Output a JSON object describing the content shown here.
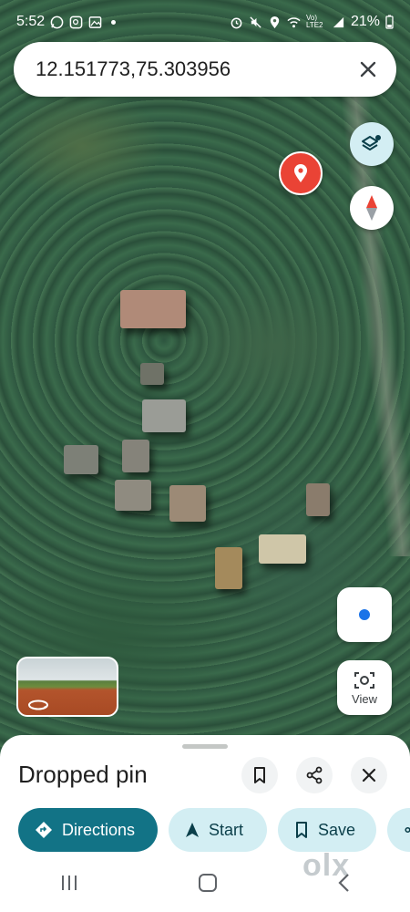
{
  "status_bar": {
    "time": "5:52",
    "network_label": "Vo) LTE2",
    "battery": "21%"
  },
  "search": {
    "query": "12.151773,75.303956"
  },
  "map_controls": {
    "view_label": "View"
  },
  "place_sheet": {
    "title": "Dropped pin",
    "actions": [
      {
        "label": "Directions",
        "icon": "directions-icon"
      },
      {
        "label": "Start",
        "icon": "navigation-icon"
      },
      {
        "label": "Save",
        "icon": "bookmark-icon"
      }
    ]
  },
  "watermark": "olx",
  "colors": {
    "pin": "#ea4335",
    "primary_chip": "#127386",
    "tonal_chip": "#d3eef3",
    "location_dot": "#1a73e8"
  }
}
